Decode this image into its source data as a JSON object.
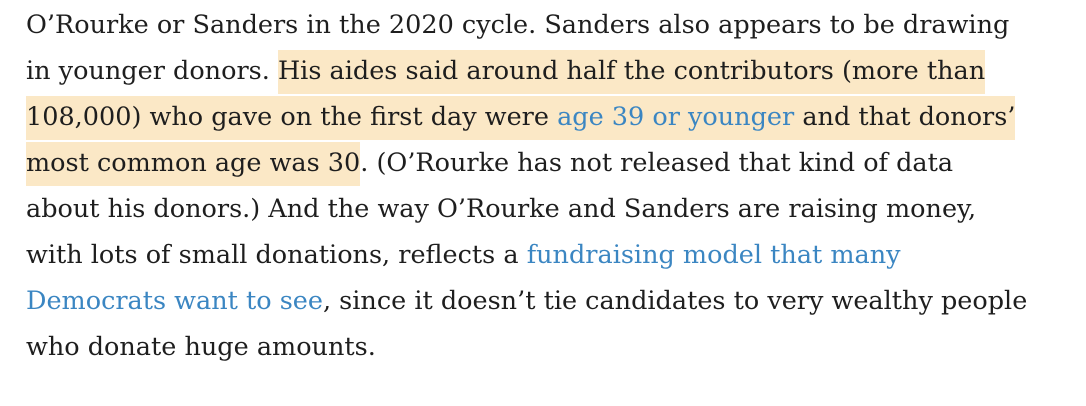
{
  "article": {
    "lines": {
      "l0": "O’Rourke or Sanders in the 2020 cycle. Sanders also appears to be drawing",
      "l1a": "in younger donors. ",
      "l1b": "His aides said around half the contributors (more than",
      "l2a": "108,000) who gave on the first day were ",
      "l2link": "age 39 or younger",
      "l2b": " and that donors’",
      "l3a": "most common age was 30",
      "l3b": ". (O’Rourke has not released that kind of data",
      "l4": "about his donors.) And the way O’Rourke and Sanders are raising money,",
      "l5a": "with lots of small donations, reflects a ",
      "l5link": "fundraising model that many",
      "l6link": "Democrats want to see",
      "l6b": ", since it doesn’t tie candidates to very wealthy people",
      "l7": "who donate huge amounts."
    },
    "highlight_color": "#fbe8c6",
    "link_color": "#3b86c2",
    "text_color": "#1e1e1e"
  }
}
